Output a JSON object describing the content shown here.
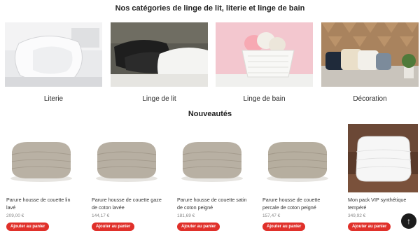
{
  "categories_section": {
    "title": "Nos catégories de linge de lit, literie et linge de bain",
    "items": [
      {
        "label": "Literie"
      },
      {
        "label": "Linge de lit"
      },
      {
        "label": "Linge de bain"
      },
      {
        "label": "Décoration"
      }
    ]
  },
  "new_section": {
    "title": "Nouveautés",
    "products": [
      {
        "name": "Parure housse de couette lin lavé",
        "price": "209,00 €",
        "button": "Ajouter au panier"
      },
      {
        "name": "Parure housse de couette gaze de coton lavée",
        "price": "144,17 €",
        "button": "Ajouter au panier"
      },
      {
        "name": "Parure housse de couette satin de coton peigné",
        "price": "181,69 €",
        "button": "Ajouter au panier"
      },
      {
        "name": "Parure housse de couette percale de coton peigné",
        "price": "157,47 €",
        "button": "Ajouter au panier"
      },
      {
        "name": "Mon pack VIP synthétique tempéré",
        "price": "349,92 €",
        "button": "Ajouter au panier"
      }
    ]
  },
  "scroll_top": {
    "icon": "arrow-up-icon",
    "glyph": "↑"
  },
  "colors": {
    "accent": "#e0302a",
    "dark": "#1c1c1c",
    "linen": "#b7afa2"
  }
}
